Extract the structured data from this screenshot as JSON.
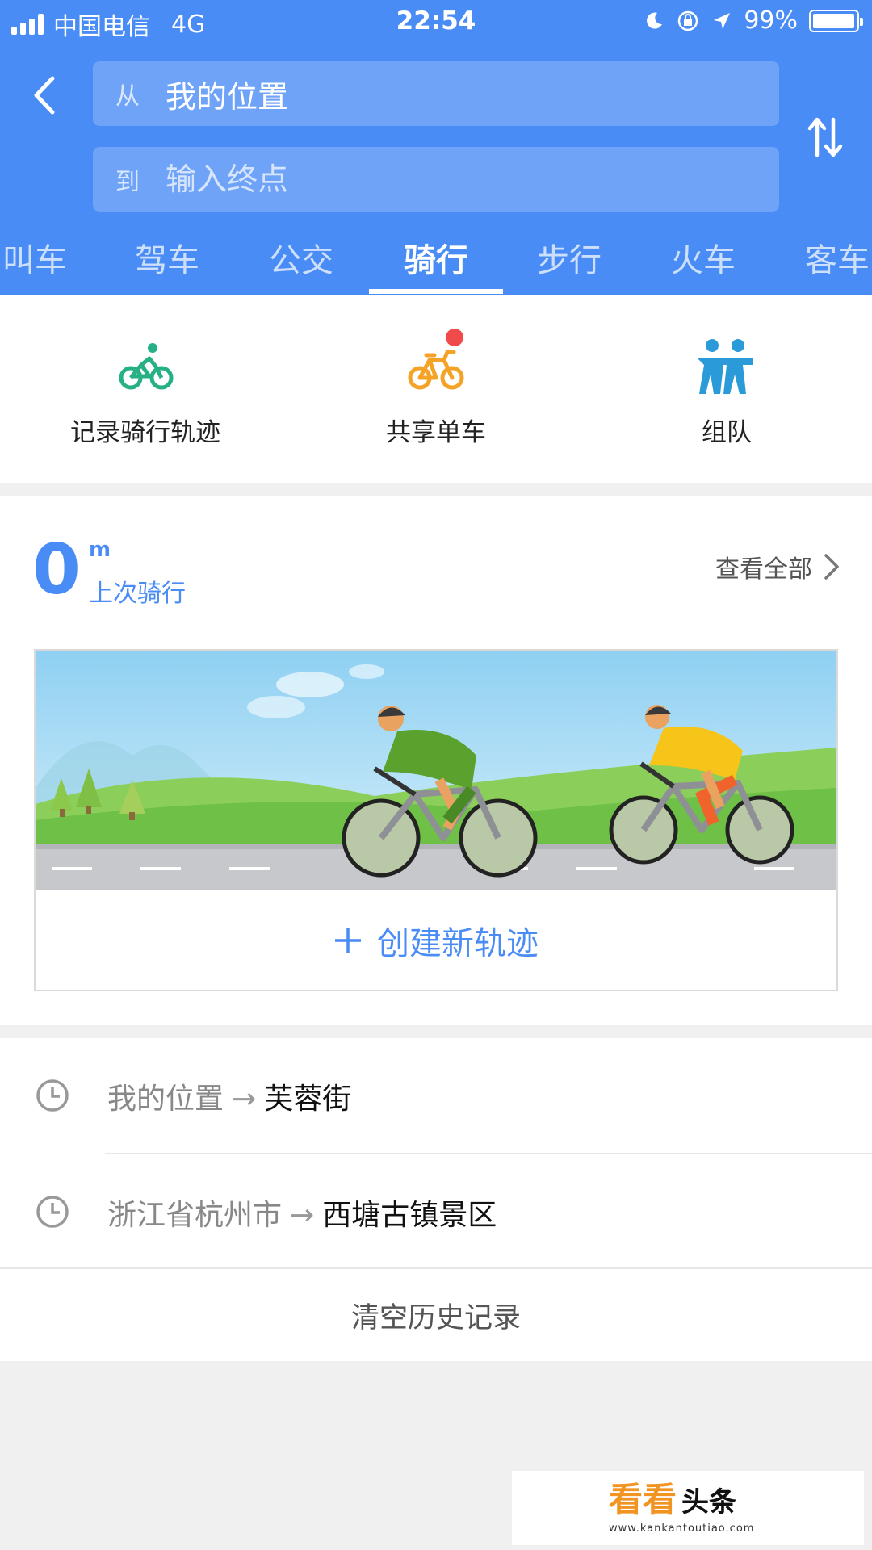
{
  "status_bar": {
    "carrier": "中国电信",
    "network": "4G",
    "time": "22:54",
    "battery": "99%",
    "battery_level": 0.99,
    "icons": [
      "signal-icon",
      "moon-icon",
      "orientation-lock-icon",
      "location-arrow-icon",
      "battery-icon"
    ]
  },
  "route": {
    "from_prefix": "从",
    "from_value": "我的位置",
    "to_prefix": "到",
    "to_placeholder": "输入终点"
  },
  "tabs": [
    {
      "label": "叫车"
    },
    {
      "label": "驾车"
    },
    {
      "label": "公交"
    },
    {
      "label": "骑行",
      "active": true
    },
    {
      "label": "步行"
    },
    {
      "label": "火车"
    },
    {
      "label": "客车"
    }
  ],
  "quick_actions": [
    {
      "label": "记录骑行轨迹",
      "icon": "cyclist-icon",
      "color": "#26b086"
    },
    {
      "label": "共享单车",
      "icon": "shared-bike-icon",
      "color": "#f4a326",
      "badge_color": "#f04a4a"
    },
    {
      "label": "组队",
      "icon": "team-icon",
      "color": "#2a9bd8"
    }
  ],
  "last_ride": {
    "distance": "0",
    "unit": "m",
    "caption": "上次骑行",
    "view_all": "查看全部"
  },
  "create_track": {
    "label": "创建新轨迹",
    "icon": "plus-icon"
  },
  "history": [
    {
      "from": "我的位置",
      "to": "芙蓉街"
    },
    {
      "from": "浙江省杭州市",
      "to": "西塘古镇景区"
    }
  ],
  "clear_history": "清空历史记录",
  "watermark": {
    "main_a": "看看",
    "main_b": "头条",
    "url": "www.kankantoutiao.com"
  },
  "colors": {
    "header_bg": "#4a8cf5",
    "accent": "#4a8cf5",
    "page_bg": "#f0f0f0"
  }
}
